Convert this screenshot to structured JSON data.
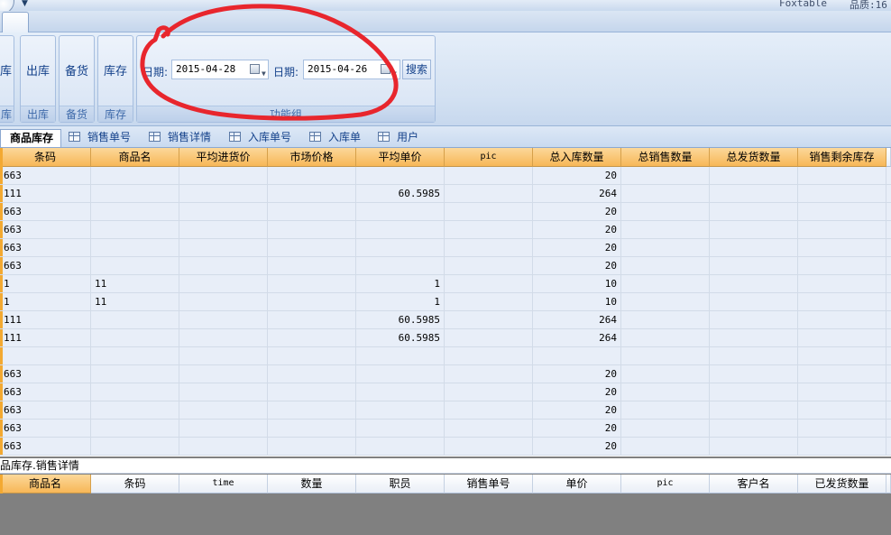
{
  "titlebar": {
    "right_text_1": "Foxtable",
    "right_text_2": "品质:16"
  },
  "ribbon": {
    "groups": [
      {
        "button": "库",
        "caption": "库"
      },
      {
        "button": "出库",
        "caption": "出库"
      },
      {
        "button": "备货",
        "caption": "备货"
      },
      {
        "button": "库存",
        "caption": "库存"
      }
    ],
    "filter_group": {
      "date1_label": "日期:",
      "date1_value": "2015-04-28",
      "date2_label": "日期:",
      "date2_value": "2015-04-26",
      "search_label": "搜索",
      "caption": "功能组"
    }
  },
  "annotation": {
    "color": "#e8262d"
  },
  "doc_tabs": [
    {
      "label": "商品库存",
      "active": true
    },
    {
      "label": "销售单号",
      "active": false
    },
    {
      "label": "销售详情",
      "active": false
    },
    {
      "label": "入库单号",
      "active": false
    },
    {
      "label": "入库单",
      "active": false
    },
    {
      "label": "用户",
      "active": false
    }
  ],
  "main_table": {
    "columns": [
      "条码",
      "商品名",
      "平均进货价",
      "市场价格",
      "平均单价",
      "pic",
      "总入库数量",
      "总销售数量",
      "总发货数量",
      "销售剩余库存"
    ],
    "rows": [
      [
        "663",
        "",
        "",
        "",
        "",
        "",
        "20",
        "",
        "",
        ""
      ],
      [
        "111",
        "",
        "",
        "",
        "60.5985",
        "",
        "264",
        "",
        "",
        ""
      ],
      [
        "663",
        "",
        "",
        "",
        "",
        "",
        "20",
        "",
        "",
        ""
      ],
      [
        "663",
        "",
        "",
        "",
        "",
        "",
        "20",
        "",
        "",
        ""
      ],
      [
        "663",
        "",
        "",
        "",
        "",
        "",
        "20",
        "",
        "",
        ""
      ],
      [
        "663",
        "",
        "",
        "",
        "",
        "",
        "20",
        "",
        "",
        ""
      ],
      [
        "1",
        "11",
        "",
        "",
        "1",
        "",
        "10",
        "",
        "",
        ""
      ],
      [
        "1",
        "11",
        "",
        "",
        "1",
        "",
        "10",
        "",
        "",
        ""
      ],
      [
        "111",
        "",
        "",
        "",
        "60.5985",
        "",
        "264",
        "",
        "",
        ""
      ],
      [
        "111",
        "",
        "",
        "",
        "60.5985",
        "",
        "264",
        "",
        "",
        ""
      ],
      [
        "",
        "",
        "",
        "",
        "",
        "",
        "",
        "",
        "",
        ""
      ],
      [
        "663",
        "",
        "",
        "",
        "",
        "",
        "20",
        "",
        "",
        ""
      ],
      [
        "663",
        "",
        "",
        "",
        "",
        "",
        "20",
        "",
        "",
        ""
      ],
      [
        "663",
        "",
        "",
        "",
        "",
        "",
        "20",
        "",
        "",
        ""
      ],
      [
        "663",
        "",
        "",
        "",
        "",
        "",
        "20",
        "",
        "",
        ""
      ],
      [
        "663",
        "",
        "",
        "",
        "",
        "",
        "20",
        "",
        "",
        ""
      ]
    ]
  },
  "detail": {
    "caption": "品库存.销售详情",
    "columns": [
      "商品名",
      "条码",
      "time",
      "数量",
      "职员",
      "销售单号",
      "单价",
      "pic",
      "客户名",
      "已发货数量"
    ]
  }
}
